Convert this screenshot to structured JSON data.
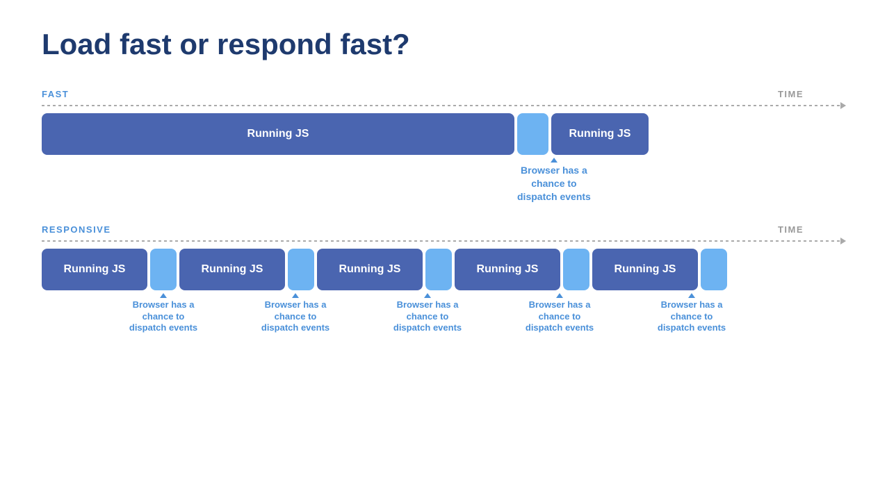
{
  "title": "Load fast or respond fast?",
  "fast_section": {
    "label": "FAST",
    "time_label": "TIME",
    "running_js_label": "Running JS",
    "running_js2_label": "Running JS",
    "annotation": "Browser has a\nchance to\ndispatch events"
  },
  "responsive_section": {
    "label": "RESPONSIVE",
    "time_label": "TIME",
    "running_js_labels": [
      "Running JS",
      "Running JS",
      "Running JS",
      "Running JS",
      "Running JS"
    ],
    "annotation": "Browser has a\nchance to\ndispatch events",
    "annotations": [
      "Browser has a chance to dispatch events",
      "Browser has a chance to dispatch events",
      "Browser has a chance to dispatch events",
      "Browser has a chance to dispatch events",
      "Browser has a chance to dispatch events"
    ]
  }
}
